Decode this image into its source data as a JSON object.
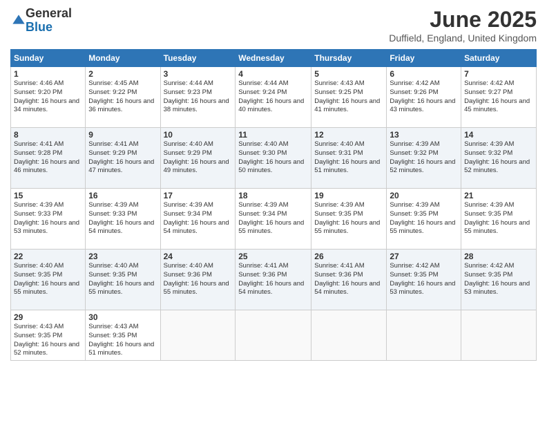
{
  "logo": {
    "general": "General",
    "blue": "Blue"
  },
  "title": "June 2025",
  "location": "Duffield, England, United Kingdom",
  "headers": [
    "Sunday",
    "Monday",
    "Tuesday",
    "Wednesday",
    "Thursday",
    "Friday",
    "Saturday"
  ],
  "weeks": [
    [
      {
        "day": "1",
        "sunrise": "4:46 AM",
        "sunset": "9:20 PM",
        "daylight": "16 hours and 34 minutes."
      },
      {
        "day": "2",
        "sunrise": "4:45 AM",
        "sunset": "9:22 PM",
        "daylight": "16 hours and 36 minutes."
      },
      {
        "day": "3",
        "sunrise": "4:44 AM",
        "sunset": "9:23 PM",
        "daylight": "16 hours and 38 minutes."
      },
      {
        "day": "4",
        "sunrise": "4:44 AM",
        "sunset": "9:24 PM",
        "daylight": "16 hours and 40 minutes."
      },
      {
        "day": "5",
        "sunrise": "4:43 AM",
        "sunset": "9:25 PM",
        "daylight": "16 hours and 41 minutes."
      },
      {
        "day": "6",
        "sunrise": "4:42 AM",
        "sunset": "9:26 PM",
        "daylight": "16 hours and 43 minutes."
      },
      {
        "day": "7",
        "sunrise": "4:42 AM",
        "sunset": "9:27 PM",
        "daylight": "16 hours and 45 minutes."
      }
    ],
    [
      {
        "day": "8",
        "sunrise": "4:41 AM",
        "sunset": "9:28 PM",
        "daylight": "16 hours and 46 minutes."
      },
      {
        "day": "9",
        "sunrise": "4:41 AM",
        "sunset": "9:29 PM",
        "daylight": "16 hours and 47 minutes."
      },
      {
        "day": "10",
        "sunrise": "4:40 AM",
        "sunset": "9:29 PM",
        "daylight": "16 hours and 49 minutes."
      },
      {
        "day": "11",
        "sunrise": "4:40 AM",
        "sunset": "9:30 PM",
        "daylight": "16 hours and 50 minutes."
      },
      {
        "day": "12",
        "sunrise": "4:40 AM",
        "sunset": "9:31 PM",
        "daylight": "16 hours and 51 minutes."
      },
      {
        "day": "13",
        "sunrise": "4:39 AM",
        "sunset": "9:32 PM",
        "daylight": "16 hours and 52 minutes."
      },
      {
        "day": "14",
        "sunrise": "4:39 AM",
        "sunset": "9:32 PM",
        "daylight": "16 hours and 52 minutes."
      }
    ],
    [
      {
        "day": "15",
        "sunrise": "4:39 AM",
        "sunset": "9:33 PM",
        "daylight": "16 hours and 53 minutes."
      },
      {
        "day": "16",
        "sunrise": "4:39 AM",
        "sunset": "9:33 PM",
        "daylight": "16 hours and 54 minutes."
      },
      {
        "day": "17",
        "sunrise": "4:39 AM",
        "sunset": "9:34 PM",
        "daylight": "16 hours and 54 minutes."
      },
      {
        "day": "18",
        "sunrise": "4:39 AM",
        "sunset": "9:34 PM",
        "daylight": "16 hours and 55 minutes."
      },
      {
        "day": "19",
        "sunrise": "4:39 AM",
        "sunset": "9:35 PM",
        "daylight": "16 hours and 55 minutes."
      },
      {
        "day": "20",
        "sunrise": "4:39 AM",
        "sunset": "9:35 PM",
        "daylight": "16 hours and 55 minutes."
      },
      {
        "day": "21",
        "sunrise": "4:39 AM",
        "sunset": "9:35 PM",
        "daylight": "16 hours and 55 minutes."
      }
    ],
    [
      {
        "day": "22",
        "sunrise": "4:40 AM",
        "sunset": "9:35 PM",
        "daylight": "16 hours and 55 minutes."
      },
      {
        "day": "23",
        "sunrise": "4:40 AM",
        "sunset": "9:35 PM",
        "daylight": "16 hours and 55 minutes."
      },
      {
        "day": "24",
        "sunrise": "4:40 AM",
        "sunset": "9:36 PM",
        "daylight": "16 hours and 55 minutes."
      },
      {
        "day": "25",
        "sunrise": "4:41 AM",
        "sunset": "9:36 PM",
        "daylight": "16 hours and 54 minutes."
      },
      {
        "day": "26",
        "sunrise": "4:41 AM",
        "sunset": "9:36 PM",
        "daylight": "16 hours and 54 minutes."
      },
      {
        "day": "27",
        "sunrise": "4:42 AM",
        "sunset": "9:35 PM",
        "daylight": "16 hours and 53 minutes."
      },
      {
        "day": "28",
        "sunrise": "4:42 AM",
        "sunset": "9:35 PM",
        "daylight": "16 hours and 53 minutes."
      }
    ],
    [
      {
        "day": "29",
        "sunrise": "4:43 AM",
        "sunset": "9:35 PM",
        "daylight": "16 hours and 52 minutes."
      },
      {
        "day": "30",
        "sunrise": "4:43 AM",
        "sunset": "9:35 PM",
        "daylight": "16 hours and 51 minutes."
      },
      null,
      null,
      null,
      null,
      null
    ]
  ]
}
